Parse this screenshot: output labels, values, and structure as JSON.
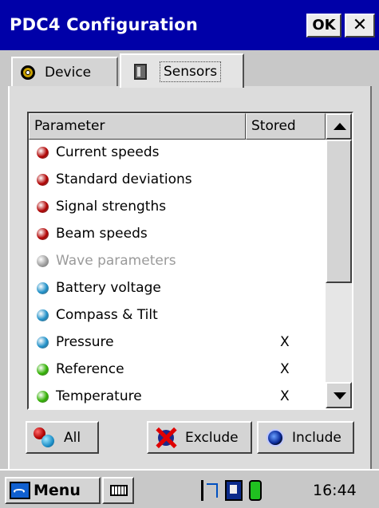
{
  "window": {
    "title": "PDC4 Configuration",
    "ok_label": "OK",
    "close_label": "✕"
  },
  "tabs": [
    {
      "label": "Device",
      "icon": "gear-icon",
      "selected": false
    },
    {
      "label": "Sensors",
      "icon": "sensor-icon",
      "selected": true
    }
  ],
  "grid": {
    "headers": {
      "parameter": "Parameter",
      "stored": "Stored"
    },
    "rows": [
      {
        "name": "Current speeds",
        "stored": "",
        "color": "#b00000",
        "enabled": true
      },
      {
        "name": "Standard deviations",
        "stored": "",
        "color": "#b00000",
        "enabled": true
      },
      {
        "name": "Signal strengths",
        "stored": "",
        "color": "#b00000",
        "enabled": true
      },
      {
        "name": "Beam speeds",
        "stored": "",
        "color": "#b00000",
        "enabled": true
      },
      {
        "name": "Wave parameters",
        "stored": "",
        "color": "#a0a0a0",
        "enabled": false
      },
      {
        "name": "Battery voltage",
        "stored": "",
        "color": "#1d8fc8",
        "enabled": true
      },
      {
        "name": "Compass & Tilt",
        "stored": "",
        "color": "#1d8fc8",
        "enabled": true
      },
      {
        "name": "Pressure",
        "stored": "X",
        "color": "#1d8fc8",
        "enabled": true
      },
      {
        "name": "Reference",
        "stored": "X",
        "color": "#30b000",
        "enabled": true
      },
      {
        "name": "Temperature",
        "stored": "X",
        "color": "#30b000",
        "enabled": true
      }
    ]
  },
  "buttons": {
    "all": "All",
    "exclude": "Exclude",
    "include": "Include"
  },
  "taskbar": {
    "menu_label": "Menu",
    "clock": "16:44"
  }
}
